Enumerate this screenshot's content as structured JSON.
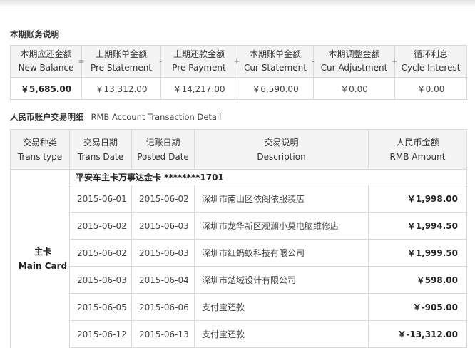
{
  "summary_section": {
    "title": "本期账务说明",
    "columns": [
      {
        "zh": "本期应还金额",
        "en": "New Balance",
        "op": "",
        "value": "￥5,685.00"
      },
      {
        "zh": "上期账单金额",
        "en": "Pre Statement",
        "op": "=",
        "value": "￥13,312.00"
      },
      {
        "zh": "上期还款金额",
        "en": "Pre Payment",
        "op": "-",
        "value": "￥14,217.00"
      },
      {
        "zh": "本期账单金额",
        "en": "Cur Statement",
        "op": "+",
        "value": "￥6,590.00"
      },
      {
        "zh": "本期调整金额",
        "en": "Cur Adjustment",
        "op": "-",
        "value": "￥0.00"
      },
      {
        "zh": "循环利息",
        "en": "Cycle Interest",
        "op": "+",
        "value": "￥0.00"
      }
    ]
  },
  "detail_section": {
    "title_zh": "人民币账户交易明细",
    "title_en": "RMB Account Transaction Detail",
    "headers": [
      {
        "zh": "交易种类",
        "en": "Trans type"
      },
      {
        "zh": "交易日期",
        "en": "Trans Date"
      },
      {
        "zh": "记账日期",
        "en": "Posted Date"
      },
      {
        "zh": "交易说明",
        "en": "Description"
      },
      {
        "zh": "人民币金额",
        "en": "RMB Amount"
      }
    ],
    "card_type_zh": "主卡",
    "card_type_en": "Main Card",
    "card_name": "平安车主卡万事达金卡 ********1701",
    "transactions": [
      {
        "trans_date": "2015-06-01",
        "posted_date": "2015-06-02",
        "description": "深圳市南山区依阁依服装店",
        "amount": "￥1,998.00"
      },
      {
        "trans_date": "2015-06-02",
        "posted_date": "2015-06-03",
        "description": "深圳市龙华新区观澜小莫电脑维修店",
        "amount": "￥1,994.50"
      },
      {
        "trans_date": "2015-06-02",
        "posted_date": "2015-06-03",
        "description": "深圳市红蚂蚁科技有限公司",
        "amount": "￥1,999.50"
      },
      {
        "trans_date": "2015-06-03",
        "posted_date": "2015-06-04",
        "description": "深圳市楚域设计有限公司",
        "amount": "￥598.00"
      },
      {
        "trans_date": "2015-06-05",
        "posted_date": "2015-06-06",
        "description": "支付宝还款",
        "amount": "￥-905.00"
      },
      {
        "trans_date": "2015-06-12",
        "posted_date": "2015-06-13",
        "description": "支付宝还款",
        "amount": "￥-13,312.00"
      }
    ]
  }
}
